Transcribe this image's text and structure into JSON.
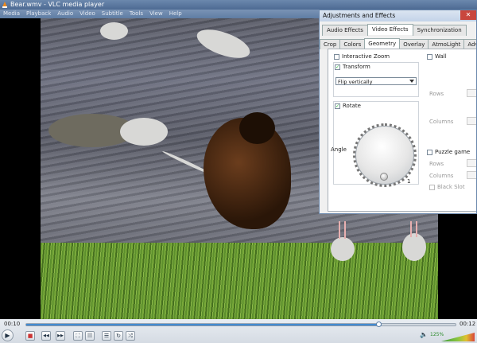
{
  "window": {
    "title": "Bear.wmv - VLC media player"
  },
  "menu": [
    "Media",
    "Playback",
    "Audio",
    "Video",
    "Subtitle",
    "Tools",
    "View",
    "Help"
  ],
  "dialog": {
    "title": "Adjustments and Effects",
    "close_glyph": "✕",
    "main_tabs": [
      "Audio Effects",
      "Video Effects",
      "Synchronization"
    ],
    "active_main_tab": "Video Effects",
    "sub_tabs": [
      "Crop",
      "Colors",
      "Geometry",
      "Overlay",
      "AtmoLight",
      "Adv"
    ],
    "active_sub_tab": "Geometry",
    "geometry": {
      "interactive_zoom": {
        "label": "Interactive Zoom",
        "checked": false
      },
      "transform": {
        "label": "Transform",
        "checked": true,
        "selected": "Flip vertically"
      },
      "rotate": {
        "label": "Rotate",
        "checked": true,
        "angle_label": "Angle",
        "value": "1"
      },
      "wall": {
        "label": "Wall",
        "checked": false,
        "rows_label": "Rows",
        "columns_label": "Columns"
      },
      "puzzle": {
        "label": "Puzzle game",
        "checked": false,
        "rows_label": "Rows",
        "columns_label": "Columns",
        "black_slot_label": "Black Slot"
      }
    }
  },
  "playback": {
    "elapsed": "00:10",
    "total": "00:12",
    "progress": 0.82,
    "volume": "125%"
  },
  "controls": {
    "play": "▶",
    "prev": "◀◀",
    "stop": "■",
    "next": "▶▶",
    "fullscreen": "⛶",
    "ext": "|||",
    "playlist": "☰",
    "loop": "↻",
    "random": "⤮",
    "speaker": "🔈"
  },
  "colors": {
    "accent": "#2a6fb8",
    "titlebar": "#5f7da4"
  }
}
